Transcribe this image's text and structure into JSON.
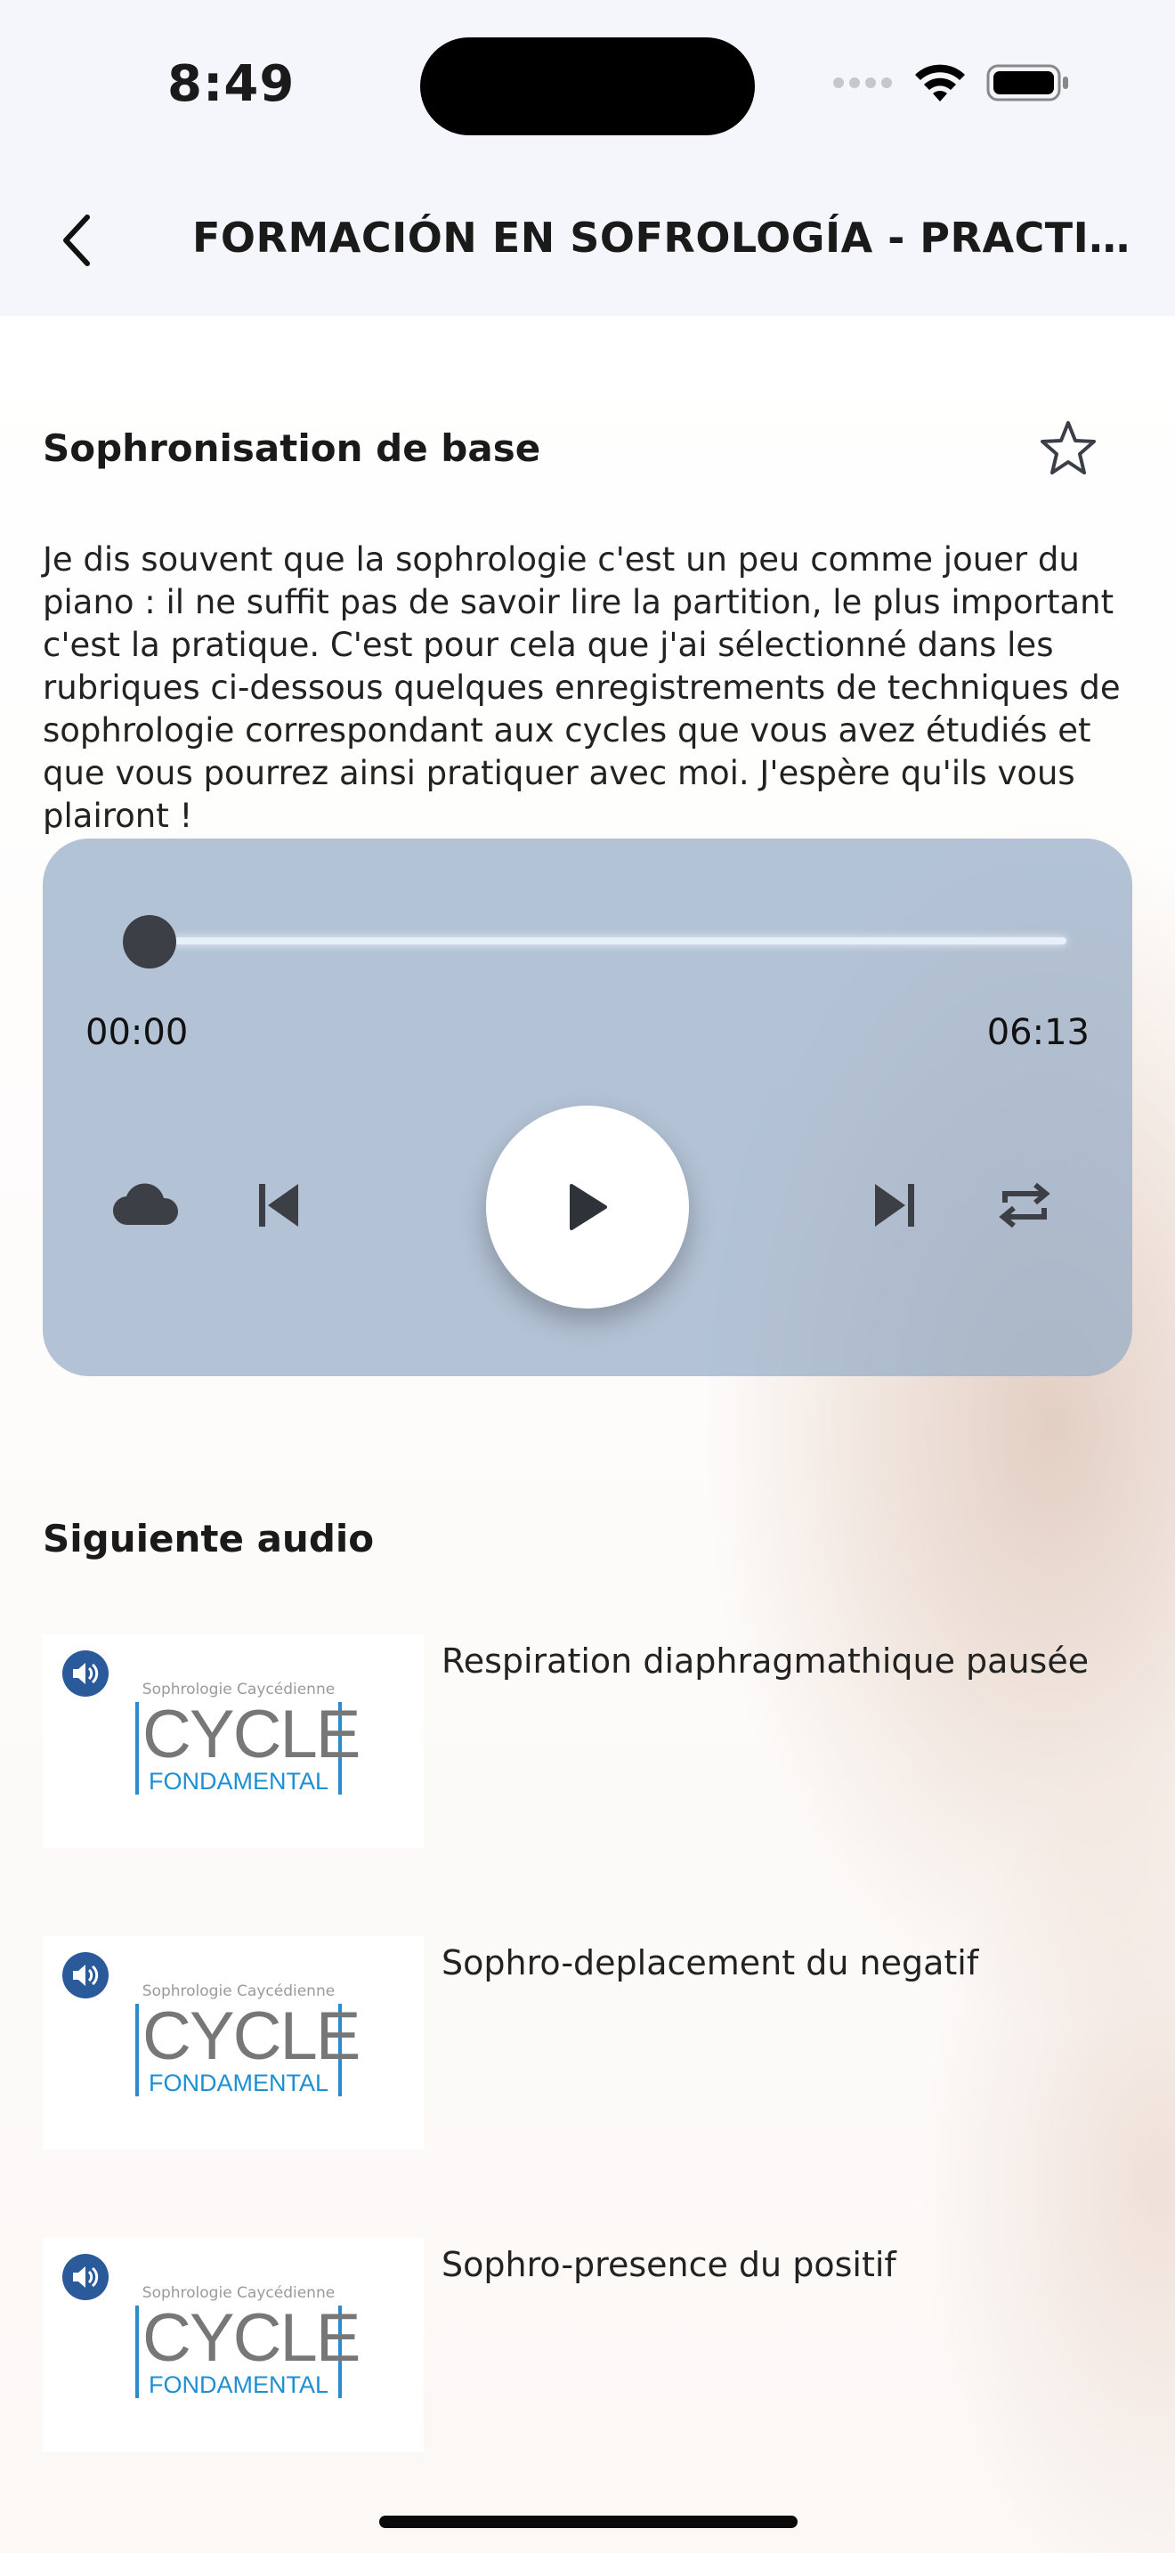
{
  "status": {
    "time": "8:49"
  },
  "nav": {
    "title": "FORMACIÓN EN SOFROLOGÍA - PRACTICA C..."
  },
  "section": {
    "title": "Sophronisation de base",
    "description": "Je dis souvent que la sophrologie c'est un peu comme jouer du piano : il ne suffit pas de savoir lire la partition, le plus important c'est la pratique. C'est pour cela que j'ai sélectionné dans les rubriques ci-dessous quelques enregistrements de techniques de sophrologie correspondant aux cycles que vous avez étudiés et que vous pourrez ainsi pratiquer avec moi. J'espère qu'ils vous plairont !"
  },
  "player": {
    "current_time": "00:00",
    "total_time": "06:13",
    "progress": 0
  },
  "next": {
    "title": "Siguiente audio",
    "items": [
      {
        "title": "Respiration diaphragmathique pausée",
        "logo_top": "Sophrologie Caycédienne",
        "logo_main": "CYCLE",
        "logo_sub": "FONDAMENTAL"
      },
      {
        "title": "Sophro-deplacement du negatif",
        "logo_top": "Sophrologie Caycédienne",
        "logo_main": "CYCLE",
        "logo_sub": "FONDAMENTAL"
      },
      {
        "title": "Sophro-presence du positif",
        "logo_top": "Sophrologie Caycédienne",
        "logo_main": "CYCLE",
        "logo_sub": "FONDAMENTAL"
      }
    ]
  }
}
